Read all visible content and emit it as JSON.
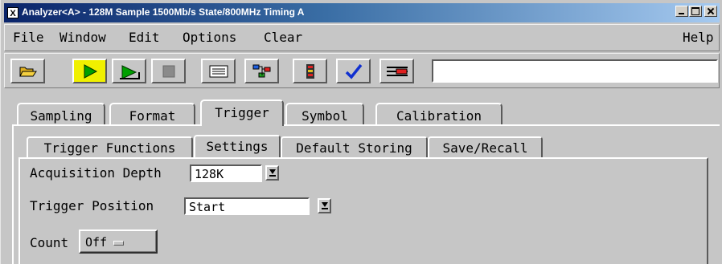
{
  "window": {
    "title": "Analyzer<A> - 128M Sample 1500Mb/s State/800MHz Timing A",
    "app_icon_glyph": "X"
  },
  "menubar": {
    "file": "File",
    "window": "Window",
    "edit": "Edit",
    "options": "Options",
    "clear": "Clear",
    "help": "Help"
  },
  "toolbar": {
    "icons": [
      "open-folder-icon",
      "run-icon",
      "run-repetitive-icon",
      "stop-icon",
      "listing-icon",
      "overview-icon",
      "properties-icon",
      "check-icon",
      "setup-tool-icon"
    ],
    "field_value": ""
  },
  "tabs": [
    "Sampling",
    "Format",
    "Trigger",
    "Symbol",
    "Calibration"
  ],
  "selected_tab": "Trigger",
  "subtabs": [
    "Trigger Functions",
    "Settings",
    "Default Storing",
    "Save/Recall"
  ],
  "selected_subtab": "Settings",
  "settings": {
    "acquisition_depth_label": "Acquisition Depth",
    "acquisition_depth_value": "128K",
    "trigger_position_label": "Trigger Position",
    "trigger_position_value": "Start",
    "count_label": "Count",
    "count_value": "Off"
  },
  "colors": {
    "title_start": "#0a246a",
    "title_end": "#a6caf0",
    "active_button": "#f0f000",
    "background": "#c6c6c6"
  }
}
